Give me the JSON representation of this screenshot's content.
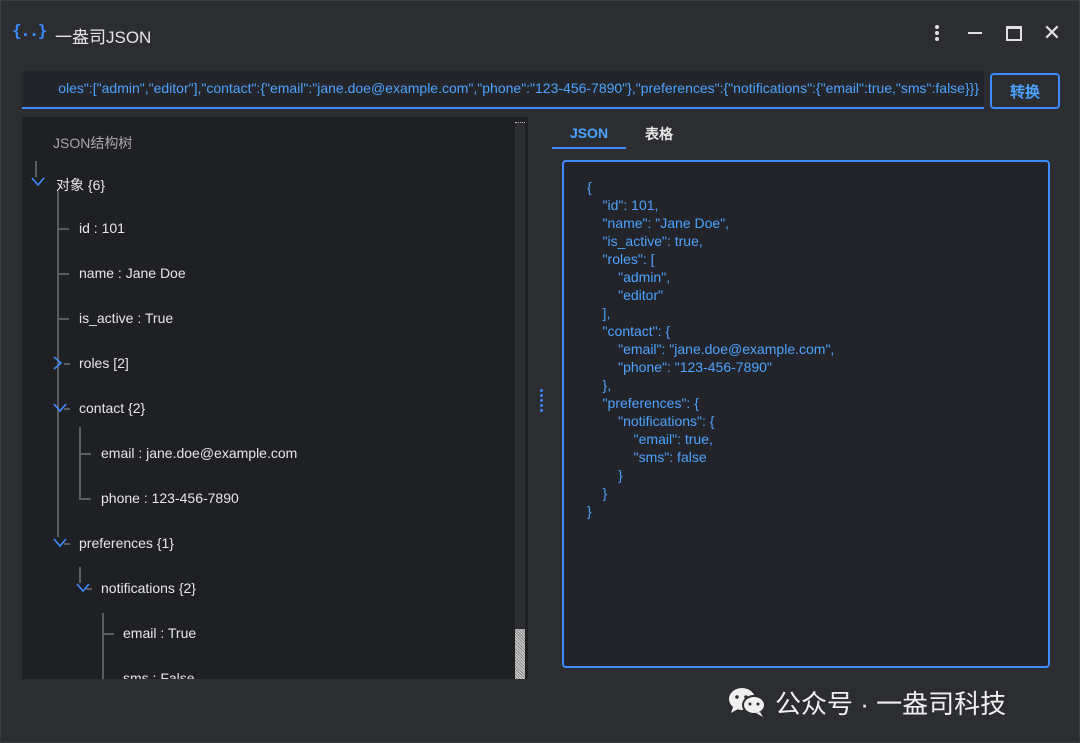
{
  "app": {
    "icon_text": "{..}",
    "title": "一盎司JSON"
  },
  "window_controls": {
    "menu_icon": "kebab-icon",
    "minimize_icon": "minimize-icon",
    "maximize_icon": "maximize-icon",
    "close_glyph": "✕"
  },
  "input": {
    "value": "oles\":[\"admin\",\"editor\"],\"contact\":{\"email\":\"jane.doe@example.com\",\"phone\":\"123-456-7890\"},\"preferences\":{\"notifications\":{\"email\":true,\"sms\":false}}}"
  },
  "convert_button": "转换",
  "tree": {
    "heading": "JSON结构树",
    "root": "对象 {6}",
    "nodes": {
      "id": "id : 101",
      "name": "name : Jane Doe",
      "is_active": "is_active : True",
      "roles": "roles [2]",
      "contact": "contact {2}",
      "contact_email": "email : jane.doe@example.com",
      "contact_phone": "phone : 123-456-7890",
      "preferences": "preferences {1}",
      "notifications": "notifications {2}",
      "notif_email": "email : True",
      "notif_sms_partial": "sms : False"
    }
  },
  "tabs": {
    "json": "JSON",
    "table": "表格"
  },
  "json_output": [
    "{",
    "    \"id\": 101,",
    "    \"name\": \"Jane Doe\",",
    "    \"is_active\": true,",
    "    \"roles\": [",
    "        \"admin\",",
    "        \"editor\"",
    "    ],",
    "    \"contact\": {",
    "        \"email\": \"jane.doe@example.com\",",
    "        \"phone\": \"123-456-7890\"",
    "    },",
    "    \"preferences\": {",
    "        \"notifications\": {",
    "            \"email\": true,",
    "            \"sms\": false",
    "        }",
    "    }",
    "}"
  ],
  "watermark": {
    "icon": "wechat-icon",
    "text": "公众号 · 一盎司科技"
  },
  "colors": {
    "accent": "#3d8bff",
    "background": "#2b2d31",
    "panel": "#1e2024"
  }
}
